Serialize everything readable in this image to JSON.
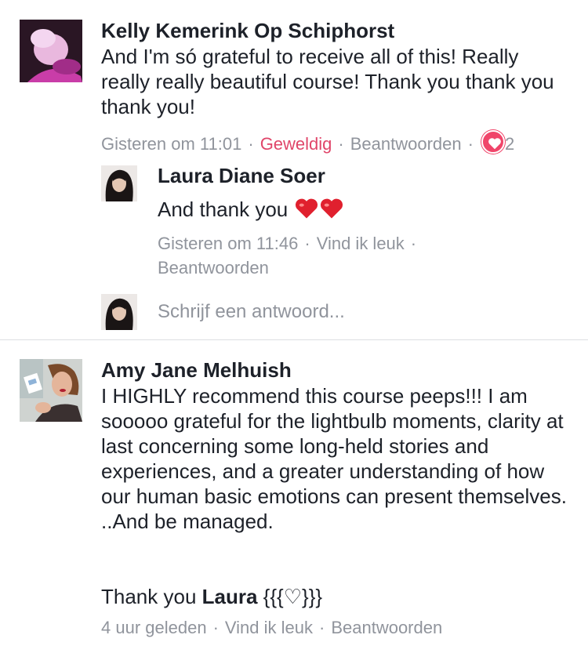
{
  "comments": [
    {
      "author": "Kelly Kemerink Op Schiphorst",
      "text": "And I'm só grateful to receive all of this! Really really really beautiful course! Thank you thank you thank you!",
      "time": "Gisteren om 11:01",
      "reaction_label": "Geweldig",
      "reply_label": "Beantwoorden",
      "reaction_icon": "heart-reaction-icon",
      "reaction_count": "2",
      "replies": [
        {
          "author": "Laura Diane Soer",
          "text": "And thank you",
          "emoji": "red-heart-emoji",
          "time": "Gisteren om 11:46",
          "like_label": "Vind ik leuk",
          "reply_label": "Beantwoorden"
        }
      ],
      "reply_input_placeholder": "Schrijf een antwoord..."
    },
    {
      "author": "Amy Jane Melhuish",
      "text": "I HIGHLY recommend this course peeps!!! I am sooooo grateful for the lightbulb moments, clarity at last concerning some long-held stories and experiences, and a greater understanding of how our human basic emotions can present themselves. ..And be managed.",
      "thanks_prefix": "Thank you ",
      "thanks_name": "Laura",
      "thanks_suffix": " {{{♡}}}",
      "time": "4 uur geleden",
      "like_label": "Vind ik leuk",
      "reply_label": "Beantwoorden"
    }
  ],
  "colors": {
    "text": "#1d2129",
    "meta": "#90949c",
    "reaction": "#e0466a",
    "divider": "#dddfe2"
  }
}
